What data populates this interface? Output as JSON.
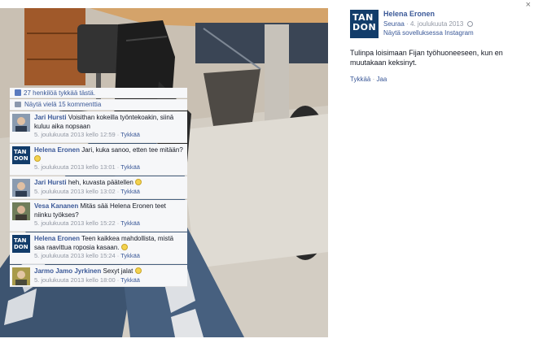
{
  "viewer": {
    "close_glyph": "×",
    "photo_alt": "Photo of legs in ripped jeans and black boots resting on an office desk"
  },
  "post": {
    "logo_line1": "TAN",
    "logo_line2": "DON",
    "author": "Helena Eronen",
    "follow": "Seuraa",
    "date": "4. joulukuuta 2013",
    "app_link": "Näytä sovelluksessa Instagram",
    "caption": "Tulinpa loisimaan Fijan työhuoneeseen, kun en muutakaan keksinyt.",
    "like_action": "Tykkää",
    "share_action": "Jaa",
    "likes_text": "27 henkilöä tykkää tästä.",
    "more_comments": "Näytä vielä 15 kommenttia"
  },
  "comments": [
    {
      "author": "Jari Hursti",
      "text": "Voisithan kokeilla työntekoakin, siinä kuluu aika nopsaan",
      "meta": "5. joulukuuta 2013 kello 12:59",
      "like": "Tykkää",
      "avatar": "person-photo"
    },
    {
      "author": "Helena Eronen",
      "text": "Jari, kuka sanoo, etten tee mitään?",
      "meta": "5. joulukuuta 2013 kello 13:01",
      "like": "Tykkää",
      "avatar": "logo"
    },
    {
      "author": "Jari Hursti",
      "text": "heh, kuvasta päätellen",
      "meta": "5. joulukuuta 2013 kello 13:02",
      "like": "Tykkää",
      "avatar": "person-photo"
    },
    {
      "author": "Vesa Kananen",
      "text": "Mitäs sää Helena Eronen teet niinku työkses?",
      "meta": "5. joulukuuta 2013 kello 15:22",
      "like": "Tykkää",
      "avatar": "person-photo"
    },
    {
      "author": "Helena Eronen",
      "text": "Teen kaikkea mahdollista, mistä saa raavittua roposia kasaan.",
      "meta": "5. joulukuuta 2013 kello 15:24",
      "like": "Tykkää",
      "avatar": "logo"
    },
    {
      "author": "Jarmo Jamo Jyrkinen",
      "text": "Sexyt jalat",
      "meta": "5. joulukuuta 2013 kello 18:00",
      "like": "Tykkää",
      "avatar": "person-photo"
    }
  ],
  "separator": "·",
  "colors": {
    "link": "#3b5998",
    "muted": "#9197a3",
    "comment_bg": "#f6f7f9",
    "logo_bg": "#123c6a"
  }
}
